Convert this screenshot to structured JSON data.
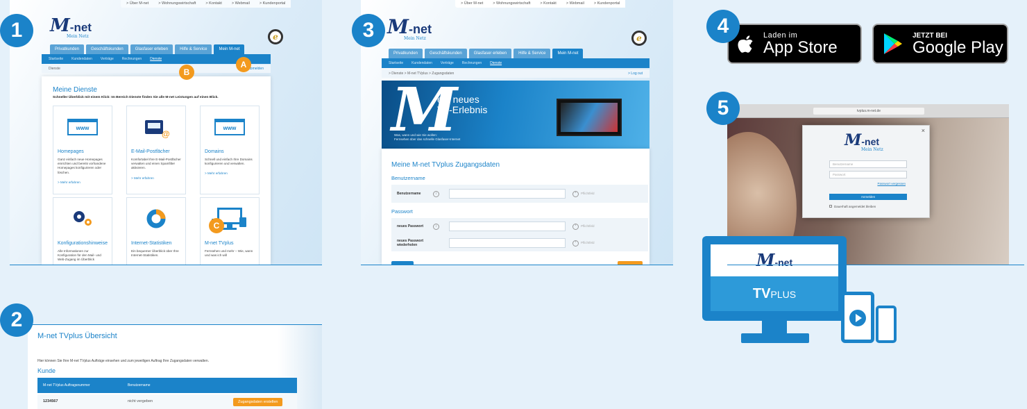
{
  "badges": {
    "b1": "1",
    "b2": "2",
    "b3": "3",
    "b4": "4",
    "b5": "5"
  },
  "markers": {
    "a": "A",
    "b": "B",
    "c": "C"
  },
  "colors": {
    "brand_blue": "#1b83c9",
    "orange": "#f39a1e",
    "background": "#e5f1fa",
    "navy": "#1a3a7a"
  },
  "site": {
    "logo_m": "M",
    "logo_net": "-net",
    "logo_tag": "Mein Netz",
    "top_nav": [
      "> Über M-net",
      "> Wohnungswirtschaft",
      "> Kontakt",
      "> Webmail",
      "> Kundenportal"
    ],
    "tabs": [
      "Privatkunden",
      "Geschäftskunden",
      "Glasfaser erleben",
      "Hilfe & Service",
      "Mein M-net"
    ],
    "sub_nav": [
      "Startseite",
      "Kundendaten",
      "Verträge",
      "Rechnungen",
      "Dienste"
    ],
    "ekomi_letter": "e"
  },
  "shot1": {
    "crumb": "Dienste",
    "logout": "> Abmelden",
    "title": "Meine Dienste",
    "lead": "Schneller Überblick mit einem Klick: Im Bereich Dienste finden Sie alle M-net Leistungen auf einen Blick.",
    "services": [
      {
        "title": "Homepages",
        "desc": "Ganz einfach neue Homepages einrichten und bereits vorhandene Homepages konfigurieren oder löschen.",
        "more": "> Mehr erfahren",
        "icon": "www-window-icon",
        "icon_text": "www"
      },
      {
        "title": "E-Mail-Postfächer",
        "desc": "Komfortabel Ihre E-Mail-Postfächer verwalten und einen Spamfilter aktivieren.",
        "more": "> Mehr erfahren",
        "icon": "mail-tray-icon",
        "icon_text": "@"
      },
      {
        "title": "Domains",
        "desc": "Schnell und einfach Ihre Domains konfigurieren und verwalten.",
        "more": "> Mehr erfahren",
        "icon": "www-cursor-icon",
        "icon_text": "www"
      },
      {
        "title": "Konfigurationshinweise",
        "desc": "Alle Informationen zur Konfiguration für den Mail- und Web-Zugang im Überblick",
        "more": "",
        "icon": "gears-icon",
        "icon_text": ""
      },
      {
        "title": "Internet-Statistiken",
        "desc": "Ein bequemer Überblick über Ihre Internet-Statistiken.",
        "more": "",
        "icon": "donut-chart-icon",
        "icon_text": ""
      },
      {
        "title": "M-net TVplus",
        "desc": "Fernsehen und mehr – Wie, wann und was ich will",
        "more": "",
        "icon": "tv-devices-icon",
        "icon_text": ""
      }
    ]
  },
  "shot2": {
    "title": "M-net TVplus Übersicht",
    "intro": "Hier können Sie Ihre M-net TVplus Aufträge einsehen und zum jeweiligen Auftrag Ihre Zugangsdaten verwalten.",
    "section": "Kunde",
    "col1": "M-net TVplus Auftragsnummer",
    "col2": "Benutzername",
    "row_number": "1234567",
    "row_user": "nicht vergeben",
    "action": "Zugangsdaten erstellen"
  },
  "shot3": {
    "crumb": "> Dienste  > M-net TVplus  > Zugangsdaten",
    "logout": "> Log out",
    "banner_line1": "ein neues",
    "banner_line2": "TV-Erlebnis",
    "banner_small1": "Was, wann und wie Sie wollen:",
    "banner_small2": "Fernsehen über das schnelle Glasfaser-Internet",
    "title": "Meine M-net TVplus Zugangsdaten",
    "section_user": "Benutzername",
    "label_user": "Benutzername",
    "section_pass": "Passwort",
    "label_newpass": "neues Passwort",
    "label_repeat": "neues Passwort wiederholen",
    "required": "Pflichtfeld",
    "info_glyph": "i",
    "req_glyph": "*"
  },
  "stores": {
    "apple_small": "Laden im",
    "apple_big": "App Store",
    "google_small": "JETZT BEI",
    "google_big": "Google Play"
  },
  "shot5": {
    "url": "tvplus.m-net.de",
    "user_placeholder": "Benutzername",
    "pass_placeholder": "Passwort",
    "forgot": "Passwort vergessen",
    "login": "Anmelden",
    "remember": "Dauerhaft angemeldet bleiben",
    "close": "×"
  },
  "tvplus": {
    "logo_m": "M",
    "logo_net": "-net",
    "tv": "TV",
    "plus": "PLUS"
  }
}
